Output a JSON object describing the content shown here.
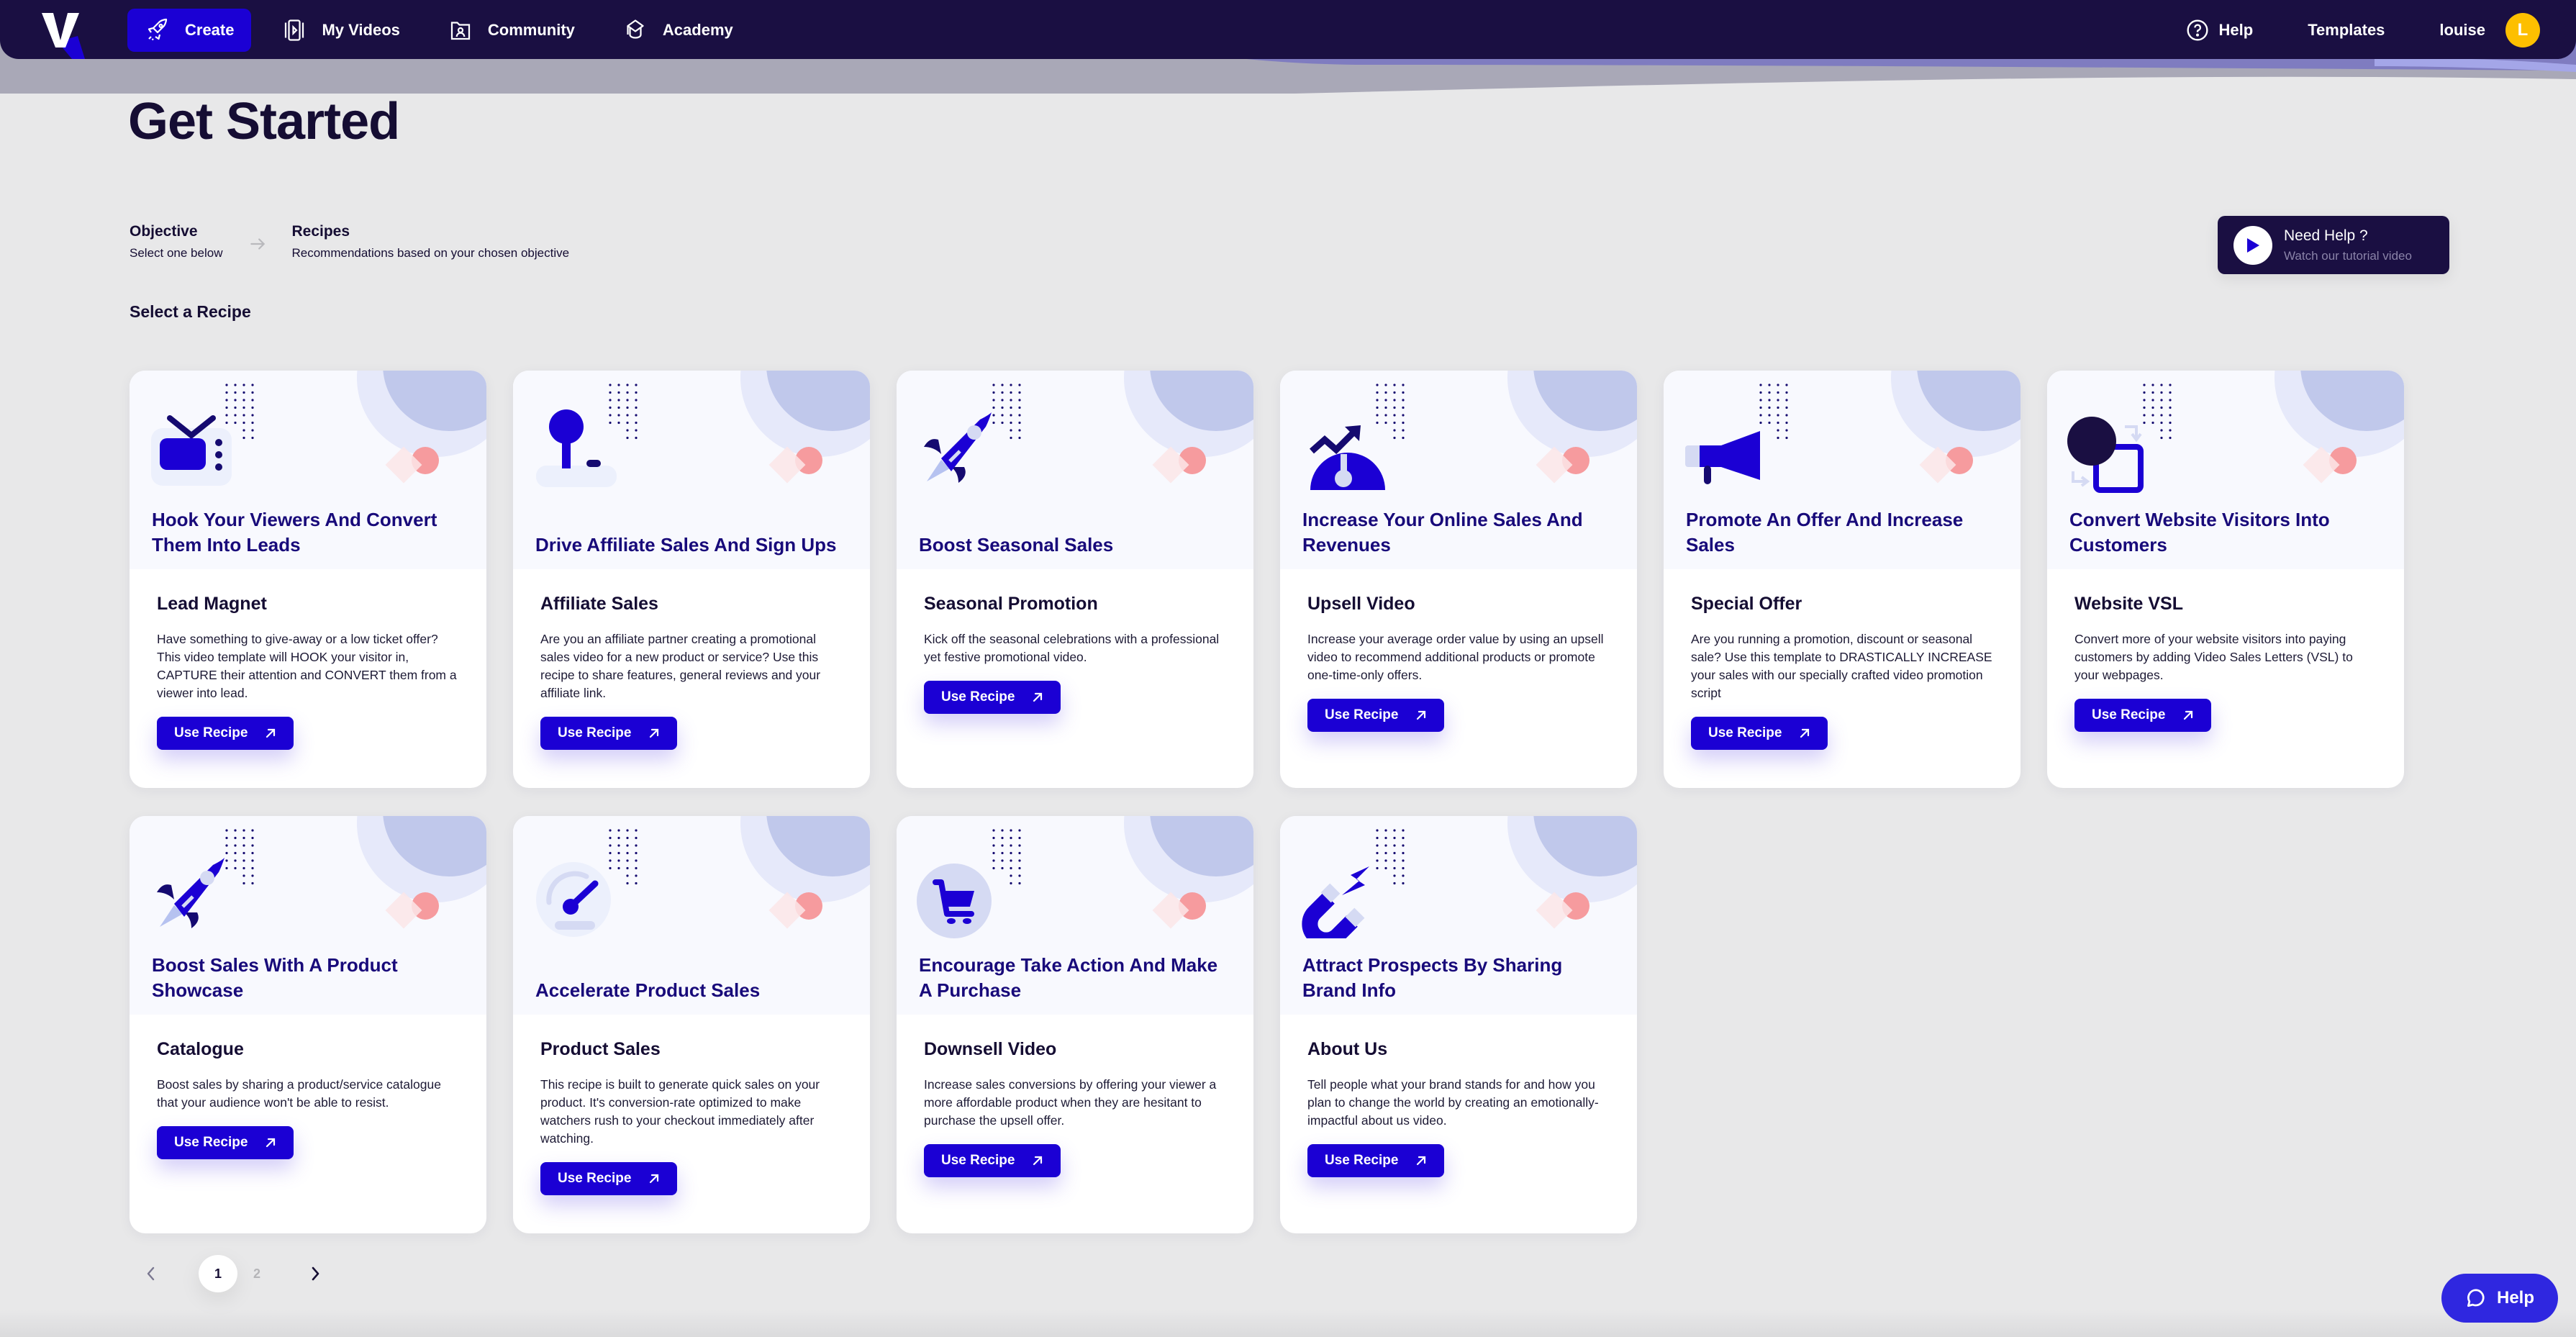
{
  "nav": {
    "logo_letter": "V",
    "items": [
      {
        "label": "Create",
        "icon": "rocket-icon",
        "active": true
      },
      {
        "label": "My Videos",
        "icon": "video-icon",
        "active": false
      },
      {
        "label": "Community",
        "icon": "community-icon",
        "active": false
      },
      {
        "label": "Academy",
        "icon": "graduation-cap-icon",
        "active": false
      }
    ],
    "help_label": "Help",
    "templates_label": "Templates",
    "username": "louise",
    "avatar_initial": "L"
  },
  "header": {
    "title": "Get Started",
    "steps": [
      {
        "title": "Objective",
        "subtitle": "Select one below"
      },
      {
        "title": "Recipes",
        "subtitle": "Recommendations based on your chosen objective"
      }
    ],
    "select_label": "Select a Recipe",
    "need_help": {
      "title": "Need Help ?",
      "subtitle": "Watch our tutorial video"
    }
  },
  "recipes": [
    {
      "objective": "Hook Your Viewers And Convert Them Into Leads",
      "name": "Lead Magnet",
      "description": "Have something to give-away or a low ticket offer? This video template will HOOK your visitor in, CAPTURE their attention and CONVERT them from a viewer into lead.",
      "button": "Use Recipe",
      "icon": "tv-icon"
    },
    {
      "objective": "Drive Affiliate Sales And Sign Ups",
      "name": "Affiliate Sales",
      "description": "Are you an affiliate partner creating a promotional sales video for a new product or service? Use this recipe to share features, general reviews and your affiliate link.",
      "button": "Use Recipe",
      "icon": "joystick-icon"
    },
    {
      "objective": "Boost Seasonal Sales",
      "name": "Seasonal Promotion",
      "description": "Kick off the seasonal celebrations with a professional yet festive promotional video.",
      "button": "Use Recipe",
      "icon": "rocket-icon"
    },
    {
      "objective": "Increase Your Online Sales And Revenues",
      "name": "Upsell Video",
      "description": "Increase your average order value by using an upsell video to recommend additional products or promote one-time-only offers.",
      "button": "Use Recipe",
      "icon": "trend-gauge-icon"
    },
    {
      "objective": "Promote An Offer And Increase Sales",
      "name": "Special Offer",
      "description": "Are you running a promotion, discount or seasonal sale? Use this template to DRASTICALLY INCREASE your sales with our specially crafted video promotion script",
      "button": "Use Recipe",
      "icon": "megaphone-icon"
    },
    {
      "objective": "Convert Website Visitors Into Customers",
      "name": "Website VSL",
      "description": "Convert more of your website visitors into paying customers by adding Video Sales Letters (VSL) to your webpages.",
      "button": "Use Recipe",
      "icon": "convert-shapes-icon"
    },
    {
      "objective": "Boost Sales With A Product Showcase",
      "name": "Catalogue",
      "description": "Boost sales by sharing a product/service catalogue that your audience won't be able to resist.",
      "button": "Use Recipe",
      "icon": "rocket-icon"
    },
    {
      "objective": "Accelerate Product Sales",
      "name": "Product Sales",
      "description": "This recipe is built to generate quick sales on your product. It's conversion-rate optimized to make watchers rush to your checkout immediately after watching.",
      "button": "Use Recipe",
      "icon": "speedometer-icon"
    },
    {
      "objective": "Encourage Take Action And Make A Purchase",
      "name": "Downsell Video",
      "description": "Increase sales conversions by offering your viewer a more affordable product when they are hesitant to purchase the upsell offer.",
      "button": "Use Recipe",
      "icon": "cart-icon"
    },
    {
      "objective": "Attract Prospects By Sharing Brand Info",
      "name": "About Us",
      "description": "Tell people what your brand stands for and how you plan to change the world by creating an emotionally-impactful about us video.",
      "button": "Use Recipe",
      "icon": "magnet-icon"
    }
  ],
  "pagination": {
    "current": "1",
    "pages": [
      "1",
      "2"
    ]
  },
  "help_fab": {
    "label": "Help"
  },
  "colors": {
    "nav_bg": "#1a0f42",
    "accent": "#1b00d4",
    "heading": "#180a7a",
    "avatar": "#fdbf00",
    "fab": "#2f27e0"
  }
}
